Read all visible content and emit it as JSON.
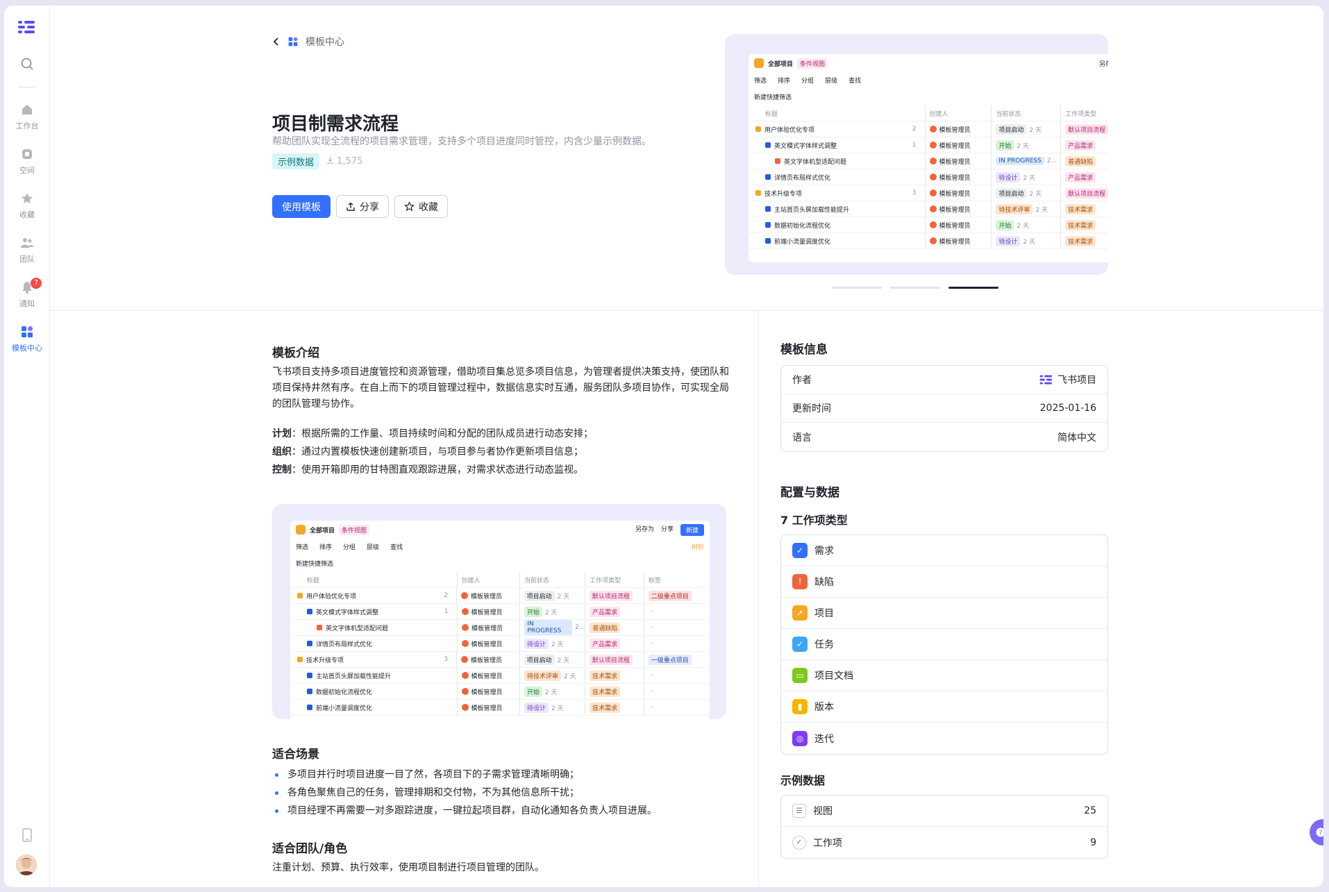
{
  "sidebar": {
    "items": [
      {
        "label": "工作台"
      },
      {
        "label": "空间"
      },
      {
        "label": "收藏"
      },
      {
        "label": "团队"
      },
      {
        "label": "通知",
        "badge": "7"
      },
      {
        "label": "模板中心"
      }
    ]
  },
  "breadcrumb": {
    "label": "模板中心"
  },
  "template": {
    "title": "项目制需求流程",
    "subtitle": "帮助团队实现全流程的项目需求管理，支持多个项目进度同时管控，内含少量示例数据。",
    "tag": "示例数据",
    "downloads": "1,575",
    "use_label": "使用模板",
    "share_label": "分享",
    "fav_label": "收藏"
  },
  "mock": {
    "title": "全部项目",
    "view": "条件视图",
    "save_as": "另存为",
    "share": "分享",
    "new": "新建",
    "tree": "树形",
    "tools": [
      "筛选",
      "排序",
      "分组",
      "层级",
      "查找"
    ],
    "quick": "新建快捷筛选",
    "cols": [
      "标题",
      "创建人",
      "当前状态",
      "工作项类型",
      "标签"
    ],
    "rows": [
      {
        "title": "用户体验优化专项",
        "count": "2",
        "creator": "模板管理员",
        "status": "项目启动",
        "days": "2 天",
        "type": "默认项目流程",
        "label": "二级重点项目"
      },
      {
        "title": "英文模式字体样式调整",
        "count": "1",
        "creator": "模板管理员",
        "status": "开始",
        "days": "2 天",
        "type": "产品需求",
        "label": "-"
      },
      {
        "title": "英文字体机型适配问题",
        "count": "",
        "creator": "模板管理员",
        "status": "IN PROGRESS",
        "days": "2...",
        "type": "普通缺陷",
        "label": "-"
      },
      {
        "title": "详情页布局样式优化",
        "count": "",
        "creator": "模板管理员",
        "status": "待设计",
        "days": "2 天",
        "type": "产品需求",
        "label": "-"
      },
      {
        "title": "技术升级专项",
        "count": "3",
        "creator": "模板管理员",
        "status": "项目启动",
        "days": "2 天",
        "type": "默认项目流程",
        "label": "一级重点项目"
      },
      {
        "title": "主站首页头屏加载性能提升",
        "count": "",
        "creator": "模板管理员",
        "status": "待技术评审",
        "days": "2 天",
        "type": "技术需求",
        "label": "-"
      },
      {
        "title": "数据初始化流程优化",
        "count": "",
        "creator": "模板管理员",
        "status": "开始",
        "days": "2 天",
        "type": "技术需求",
        "label": "-"
      },
      {
        "title": "前端小流量调度优化",
        "count": "",
        "creator": "模板管理员",
        "status": "待设计",
        "days": "2 天",
        "type": "技术需求",
        "label": "-"
      }
    ]
  },
  "intro": {
    "heading": "模板介绍",
    "body": "飞书项目支持多项目进度管控和资源管理，借助项目集总览多项目信息，为管理者提供决策支持，使团队和项目保持井然有序。在自上而下的项目管理过程中，数据信息实时互通，服务团队多项目协作，可实现全局的团队管理与协作。",
    "points": [
      {
        "k": "计划",
        "v": "根据所需的工作量、项目持续时间和分配的团队成员进行动态安排；"
      },
      {
        "k": "组织",
        "v": "通过内置模板快速创建新项目，与项目参与者协作更新项目信息；"
      },
      {
        "k": "控制",
        "v": "使用开箱即用的甘特图直观跟踪进展，对需求状态进行动态监视。"
      }
    ]
  },
  "scenes": {
    "heading": "适合场景",
    "items": [
      "多项目并行时项目进度一目了然，各项目下的子需求管理清晰明确；",
      "各角色聚焦自己的任务，管理排期和交付物，不为其他信息所干扰；",
      "项目经理不再需要一对多跟踪进度，一键拉起项目群，自动化通知各负责人项目进展。"
    ]
  },
  "teams": {
    "heading": "适合团队/角色",
    "body": "注重计划、预算、执行效率，使用项目制进行项目管理的团队。"
  },
  "info": {
    "heading": "模板信息",
    "author_label": "作者",
    "author": "飞书项目",
    "updated_label": "更新时间",
    "updated": "2025-01-16",
    "lang_label": "语言",
    "lang": "简体中文"
  },
  "config": {
    "heading": "配置与数据",
    "types_heading": "7 工作项类型",
    "types": [
      {
        "label": "需求",
        "color": "#3370ff"
      },
      {
        "label": "缺陷",
        "color": "#f0643c"
      },
      {
        "label": "项目",
        "color": "#f5a623"
      },
      {
        "label": "任务",
        "color": "#3ea6f5"
      },
      {
        "label": "项目文档",
        "color": "#7bc91a"
      },
      {
        "label": "版本",
        "color": "#f7b500"
      },
      {
        "label": "迭代",
        "color": "#7f3bf5"
      }
    ],
    "sample_heading": "示例数据",
    "sample": [
      {
        "label": "视图",
        "value": "25"
      },
      {
        "label": "工作项",
        "value": "9"
      }
    ]
  },
  "help": {
    "label": "帮助"
  }
}
